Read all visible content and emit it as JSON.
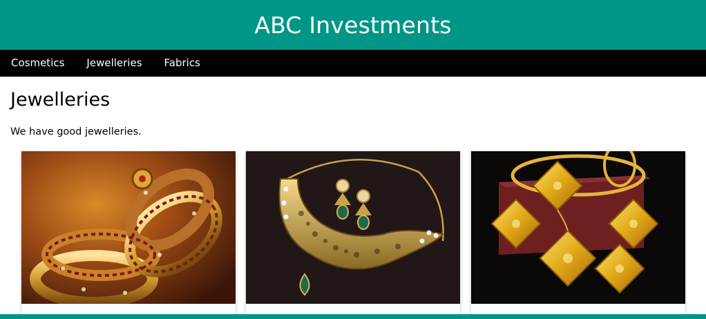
{
  "header": {
    "title": "ABC Investments"
  },
  "nav": {
    "items": [
      "Cosmetics",
      "Jewelleries",
      "Fabrics"
    ]
  },
  "page": {
    "title": "Jewelleries",
    "description": "We have good jewelleries."
  },
  "gallery": {
    "cards": [
      {
        "icon": "bangles-photo"
      },
      {
        "icon": "necklace-earrings-photo"
      },
      {
        "icon": "gold-jewellery-set-photo"
      }
    ]
  },
  "colors": {
    "brand": "#009687",
    "nav_bg": "#000000",
    "text": "#000000"
  }
}
